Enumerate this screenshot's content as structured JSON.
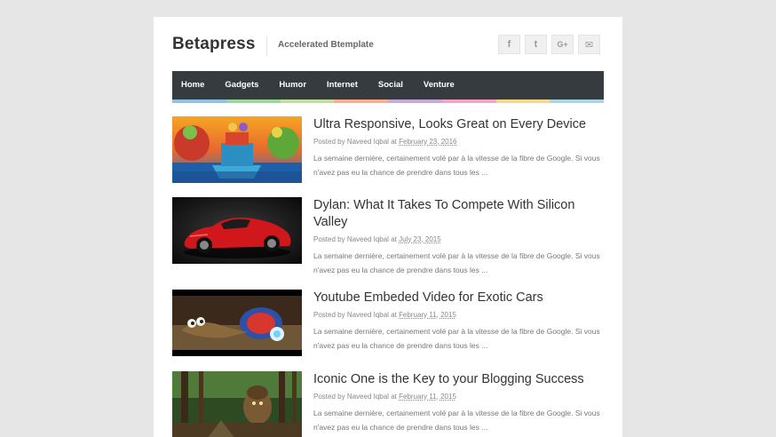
{
  "site": {
    "title": "Betapress",
    "tagline": "Accelerated Btemplate"
  },
  "social": [
    {
      "icon": "facebook-icon",
      "glyph": "f"
    },
    {
      "icon": "tumblr-icon",
      "glyph": "t"
    },
    {
      "icon": "google-plus-icon",
      "glyph": "G+"
    },
    {
      "icon": "email-icon",
      "glyph": "✉"
    }
  ],
  "nav": {
    "items": [
      "Home",
      "Gadgets",
      "Humor",
      "Internet",
      "Social",
      "Venture"
    ]
  },
  "colors": {
    "nav_bg": "#363b3f",
    "strip": [
      "#8ec3e6",
      "#9ad79d",
      "#c1e09c",
      "#f9b08e",
      "#c7a9dc",
      "#f5a3c7",
      "#f8d88c",
      "#a8d8e8"
    ]
  },
  "posts": [
    {
      "title": "Ultra Responsive, Looks Great on Every Device",
      "posted_by": "Posted by",
      "author": "Naveed Iqbal",
      "at": "at",
      "date": "February 23, 2016",
      "excerpt": "La semaine dernière, certainement volé par à la vitesse de la fibre de Google. Si vous n'avez pas eu la chance de prendre dans tous les ...",
      "thumb": "cartoon-boat-image"
    },
    {
      "title": "Dylan: What It Takes To Compete With Silicon Valley",
      "posted_by": "Posted by",
      "author": "Naveed Iqbal",
      "at": "at",
      "date": "July 23, 2015",
      "excerpt": "La semaine dernière, certainement volé par à la vitesse de la fibre de Google. Si vous n'avez pas eu la chance de prendre dans tous les ...",
      "thumb": "red-sports-car-image"
    },
    {
      "title": "Youtube Embeded Video for Exotic Cars",
      "posted_by": "Posted by",
      "author": "Naveed Iqbal",
      "at": "at",
      "date": "February 11, 2015",
      "excerpt": "La semaine dernière, certainement volé par à la vitesse de la fibre de Google. Si vous n'avez pas eu la chance de prendre dans tous les ...",
      "thumb": "racing-snail-image"
    },
    {
      "title": "Iconic One is the Key to your Blogging Success",
      "posted_by": "Posted by",
      "author": "Naveed Iqbal",
      "at": "at",
      "date": "February 11, 2015",
      "excerpt": "La semaine dernière, certainement volé par à la vitesse de la fibre de Google. Si vous n'avez pas eu la chance de prendre dans tous les ...",
      "thumb": "forest-warrior-image"
    }
  ]
}
